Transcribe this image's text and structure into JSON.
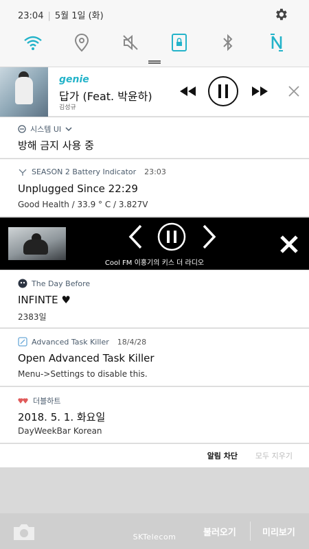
{
  "status": {
    "time": "23:04",
    "date": "5월 1일 (화)"
  },
  "quick_settings": {
    "items": [
      "wifi",
      "location",
      "sound-off",
      "lock-rotation",
      "bluetooth",
      "nfc"
    ],
    "accent": "#23b3c9"
  },
  "music": {
    "brand": "genie",
    "title": "답가 (Feat. 박윤하)",
    "artist": "김성규"
  },
  "system_ui": {
    "app_name": "시스템 UI",
    "title": "방해 금지 사용 중"
  },
  "battery": {
    "app_name": "SEASON 2 Battery Indicator",
    "time": "23:03",
    "title": "Unplugged Since 22:29",
    "text": "Good Health / 33.9 ° C / 3.827V"
  },
  "radio": {
    "caption": "Cool FM 이홍기의 키스 더 라디오"
  },
  "day_before": {
    "app_name": "The Day Before",
    "title": "INFINTE ♥",
    "text": "2383일"
  },
  "task_killer": {
    "app_name": "Advanced Task Killer",
    "time": "18/4/28",
    "title": "Open Advanced Task Killer",
    "text": "Menu->Settings to disable this."
  },
  "double_heart": {
    "app_name": "더블하트",
    "title": "2018. 5. 1. 화요일",
    "text": "DayWeekBar Korean"
  },
  "footer": {
    "block_label": "알림 차단",
    "clear_label": "모두 지우기"
  },
  "lockscreen": {
    "carrier": "SKTelecom",
    "left_button": "불러오기",
    "right_button": "미리보기"
  }
}
